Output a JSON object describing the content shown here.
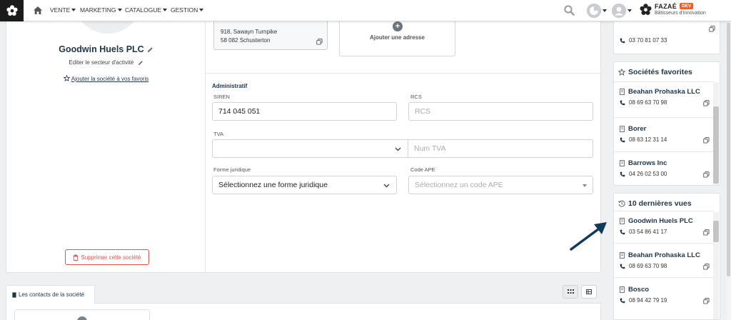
{
  "navbar": {
    "menu": [
      {
        "label": "VENTE"
      },
      {
        "label": "MARKETING"
      },
      {
        "label": "CATALOGUE"
      },
      {
        "label": "GESTION"
      }
    ],
    "brand": {
      "name": "FAZAÉ",
      "badge": "DEV",
      "tagline": "Bâtisseurs d'innovation"
    }
  },
  "company": {
    "name": "Goodwin Huels PLC",
    "sector_link": "Editer le secteur d'activité",
    "favorite_link": "Ajouter la société à vos favoris",
    "delete_label": "Supprimer cette société"
  },
  "address": {
    "line1": "918, Sawayn Turnpike",
    "line2": "58 082 Schusterton",
    "add_label": "Ajouter une adresse"
  },
  "admin": {
    "title": "Administratif",
    "siren_label": "SIREN",
    "siren_value": "714 045 051",
    "rcs_label": "RCS",
    "rcs_placeholder": "RCS",
    "tva_label": "TVA",
    "tva_placeholder": "Num TVA",
    "forme_label": "Forme juridique",
    "forme_value": "Sélectionnez une forme juridique",
    "ape_label": "Code APE",
    "ape_placeholder": "Sélectionnez un code APE"
  },
  "contacts_tab": {
    "label": "Les contacts de la société"
  },
  "sidebar": {
    "top_item": {
      "phone": "03 70 81 07 33"
    },
    "favorites": {
      "title": "Sociétés favorites",
      "items": [
        {
          "name": "Beahan Prohaska LLC",
          "phone": "08 69 63 70 98"
        },
        {
          "name": "Borer",
          "phone": "08 63 12 31 14"
        },
        {
          "name": "Barrows Inc",
          "phone": "04 26 02 53 00"
        }
      ]
    },
    "recent": {
      "title": "10 dernières vues",
      "items": [
        {
          "name": "Goodwin Huels PLC",
          "phone": "03 54 86 41 17"
        },
        {
          "name": "Beahan Prohaska LLC",
          "phone": "08 69 63 70 98"
        },
        {
          "name": "Bosco",
          "phone": "08 94 42 79 19"
        }
      ]
    }
  },
  "colors": {
    "primary": "#1f3548",
    "danger": "#d9534f",
    "arrow": "#0f3a5a",
    "badge": "#e8612c"
  },
  "icons": [
    "home-icon",
    "search-icon",
    "pencil-icon",
    "star-icon",
    "trash-icon",
    "copy-icon",
    "phone-icon",
    "building-icon",
    "history-icon",
    "grid-view-icon",
    "list-view-icon",
    "chevron-down-icon",
    "plus-icon",
    "arrow-icon"
  ]
}
